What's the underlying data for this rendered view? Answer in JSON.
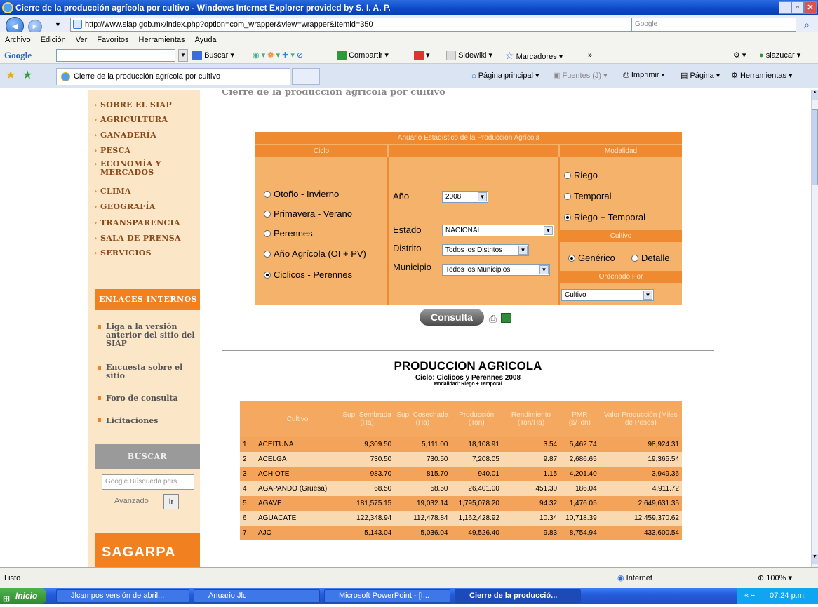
{
  "window": {
    "title": "Cierre de la producción agrícola por cultivo - Windows Internet Explorer provided by S. I. A. P.",
    "min": "_",
    "max": "▫",
    "close": "✕"
  },
  "nav": {
    "url": "http://www.siap.gob.mx/index.php?option=com_wrapper&view=wrapper&Itemid=350",
    "search_placeholder": "Google"
  },
  "menu": [
    "Archivo",
    "Edición",
    "Ver",
    "Favoritos",
    "Herramientas",
    "Ayuda"
  ],
  "googlebar": {
    "logo": "Google",
    "buscar": "Buscar",
    "compartir": "Compartir",
    "sidewiki": "Sidewiki",
    "marcadores": "Marcadores",
    "more": "»",
    "user": "siazucar"
  },
  "tabbar": {
    "tab_title": "Cierre de la producción agrícola por cultivo",
    "pagina_principal": "Página principal",
    "fuentes": "Fuentes (J)",
    "imprimir": "Imprimir",
    "pagina": "Página",
    "herramientas": "Herramientas"
  },
  "page": {
    "heading": "Cierre de la producción agrícola por cultivo"
  },
  "sidebar": {
    "items": [
      "SOBRE EL SIAP",
      "AGRICULTURA",
      "GANADERÍA",
      "PESCA",
      "ECONOMÍA Y MERCADOS",
      "CLIMA",
      "GEOGRAFÍA",
      "TRANSPARENCIA",
      "SALA DE PRENSA",
      "SERVICIOS"
    ],
    "enlaces_head": "ENLACES INTERNOS",
    "links": [
      "Liga a la versión anterior del sitio del SIAP",
      "Encuesta sobre el sitio",
      "Foro de consulta",
      "Licitaciones"
    ],
    "buscar_head": "BUSCAR",
    "search_placeholder": "Búsqueda pers",
    "google_mark": "Google",
    "avanzado": "Avanzado",
    "ir": "Ir",
    "logo": "SAGARPA"
  },
  "form": {
    "banner": "Anuario Estadístico de la Producción Agrícola",
    "ciclo_head": "Ciclo",
    "modalidad_head": "Modalidad",
    "ciclos": [
      "Otoño - Invierno",
      "Primavera - Verano",
      "Perennes",
      "Año Agrícola (OI + PV)",
      "Ciclicos - Perennes"
    ],
    "anio_label": "Año",
    "anio_value": "2008",
    "estado_label": "Estado",
    "estado_value": "NACIONAL",
    "distrito_label": "Distrito",
    "distrito_value": "Todos los Distritos",
    "municipio_label": "Municipio",
    "municipio_value": "Todos los Municipios",
    "modalidades": [
      "Riego",
      "Temporal",
      "Riego + Temporal"
    ],
    "cultivo_head": "Cultivo",
    "generico": "Genérico",
    "detalle": "Detalle",
    "ordenado_head": "Ordenado Por",
    "ordenado_value": "Cultivo",
    "consulta": "Consulta"
  },
  "report": {
    "title": "PRODUCCION AGRICOLA",
    "subtitle": "Ciclo: Ciclicos y Perennes 2008",
    "modalidad": "Modalidad: Riego + Temporal"
  },
  "table": {
    "headers": [
      "Cultivo",
      "Sup. Sembrada (Ha)",
      "Sup. Cosechada (Ha)",
      "Producción (Ton)",
      "Rendimiento (Ton/Ha)",
      "PMR ($/Ton)",
      "Valor Producción (Miles de Pesos)"
    ],
    "rows": [
      [
        "1",
        "ACEITUNA",
        "9,309.50",
        "5,111.00",
        "18,108.91",
        "3.54",
        "5,462.74",
        "98,924.31"
      ],
      [
        "2",
        "ACELGA",
        "730.50",
        "730.50",
        "7,208.05",
        "9.87",
        "2,686.65",
        "19,365.54"
      ],
      [
        "3",
        "ACHIOTE",
        "983.70",
        "815.70",
        "940.01",
        "1.15",
        "4,201.40",
        "3,949.36"
      ],
      [
        "4",
        "AGAPANDO (Gruesa)",
        "68.50",
        "58.50",
        "26,401.00",
        "451.30",
        "186.04",
        "4,911.72"
      ],
      [
        "5",
        "AGAVE",
        "181,575.15",
        "19,032.14",
        "1,795,078.20",
        "94.32",
        "1,476.05",
        "2,649,631.35"
      ],
      [
        "6",
        "AGUACATE",
        "122,348.94",
        "112,478.84",
        "1,162,428.92",
        "10.34",
        "10,718.39",
        "12,459,370.62"
      ],
      [
        "7",
        "AJO",
        "5,143.04",
        "5,036.04",
        "49,526.40",
        "9.83",
        "8,754.94",
        "433,600.54"
      ]
    ]
  },
  "status": {
    "text": "Listo",
    "zone": "Internet",
    "zoom": "100%"
  },
  "taskbar": {
    "start": "Inicio",
    "tasks": [
      "Jlcampos versión de abril...",
      "Anuario Jlc",
      "Microsoft PowerPoint - [I...",
      "Cierre de la producció..."
    ],
    "clock": "07:24 p.m."
  }
}
